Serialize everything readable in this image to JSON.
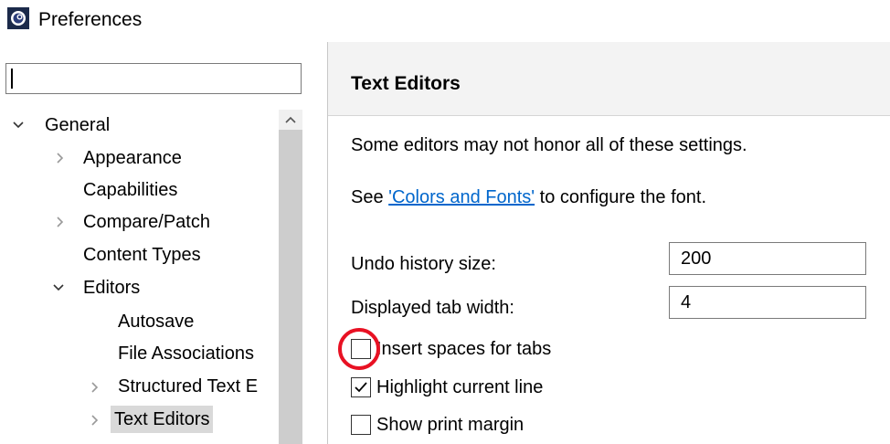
{
  "window": {
    "title": "Preferences",
    "icon": "eclipse-app-icon"
  },
  "filter": {
    "value": "",
    "placeholder": ""
  },
  "tree": {
    "items": [
      {
        "label": "General",
        "level": 0,
        "expander": "expanded"
      },
      {
        "label": "Appearance",
        "level": 1,
        "expander": "collapsed"
      },
      {
        "label": "Capabilities",
        "level": 1,
        "expander": "none"
      },
      {
        "label": "Compare/Patch",
        "level": 1,
        "expander": "collapsed"
      },
      {
        "label": "Content Types",
        "level": 1,
        "expander": "none"
      },
      {
        "label": "Editors",
        "level": 1,
        "expander": "expanded"
      },
      {
        "label": "Autosave",
        "level": 2,
        "expander": "none"
      },
      {
        "label": "File Associations",
        "level": 2,
        "expander": "none"
      },
      {
        "label": "Structured Text E",
        "level": 2,
        "expander": "collapsed"
      },
      {
        "label": "Text Editors",
        "level": 2,
        "expander": "collapsed",
        "selected": true
      }
    ]
  },
  "page": {
    "title": "Text Editors",
    "note": "Some editors may not honor all of these settings.",
    "see_prefix": "See ",
    "see_link": "'Colors and Fonts'",
    "see_suffix": " to configure the font.",
    "fields": {
      "undo_history_label": "Undo history size:",
      "undo_history_value": "200",
      "tab_width_label": "Displayed tab width:",
      "tab_width_value": "4"
    },
    "checkboxes": {
      "insert_spaces": {
        "label": "Insert spaces for tabs",
        "checked": false
      },
      "highlight_line": {
        "label": "Highlight current line",
        "checked": true
      },
      "print_margin": {
        "label": "Show print margin",
        "checked": false
      }
    }
  },
  "colors": {
    "link": "#0066cc",
    "selection": "#d9d9d9",
    "header_bg": "#f3f3f3",
    "annotation_circle": "#e81123"
  }
}
